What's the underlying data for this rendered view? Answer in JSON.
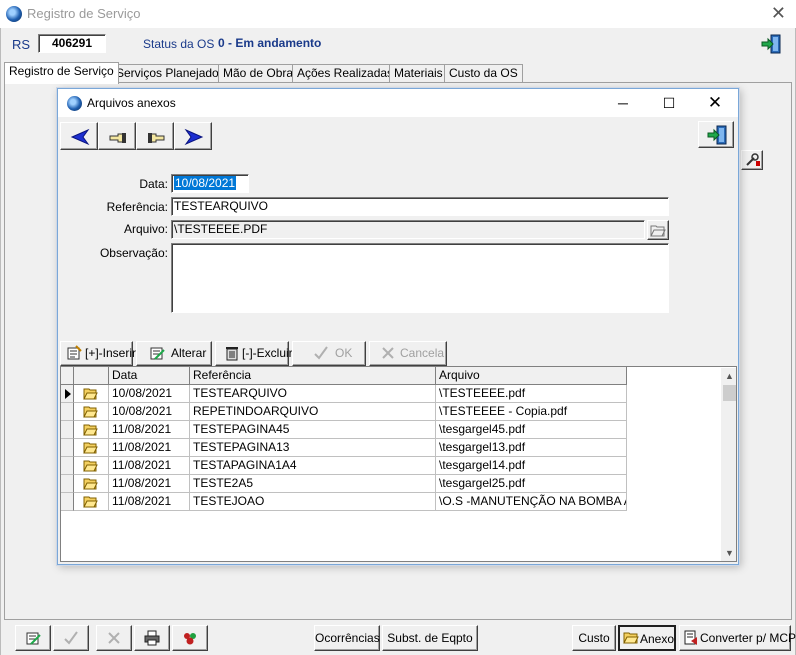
{
  "window": {
    "title": "Registro de Serviço"
  },
  "header": {
    "rs_label": "RS",
    "rs_value": "406291",
    "status_label": "Status da OS",
    "status_value": "0 - Em andamento"
  },
  "tabs": [
    {
      "label": "Registro de Serviço",
      "active": true
    },
    {
      "label": "Serviços Planejados",
      "active": false
    },
    {
      "label": "Mão de Obra",
      "active": false
    },
    {
      "label": "Ações Realizadas",
      "active": false
    },
    {
      "label": "Materiais",
      "active": false
    },
    {
      "label": "Custo da OS",
      "active": false
    }
  ],
  "dialog": {
    "title": "Arquivos anexos",
    "form": {
      "data_label": "Data:",
      "data_value": "10/08/2021",
      "referencia_label": "Referência:",
      "referencia_value": "TESTEARQUIVO",
      "arquivo_label": "Arquivo:",
      "arquivo_value": "\\TESTEEEE.PDF",
      "observacao_label": "Observação:",
      "observacao_value": ""
    },
    "grid_buttons": {
      "inserir": "[+]-Inserir",
      "alterar": "Alterar",
      "excluir": "[-]-Excluir",
      "ok": "OK",
      "cancela": "Cancela"
    },
    "grid": {
      "columns": [
        "Data",
        "Referência",
        "Arquivo"
      ],
      "rows": [
        {
          "data": "10/08/2021",
          "referencia": "TESTEARQUIVO",
          "arquivo": "\\TESTEEEE.pdf"
        },
        {
          "data": "10/08/2021",
          "referencia": "REPETINDOARQUIVO",
          "arquivo": "\\TESTEEEE - Copia.pdf"
        },
        {
          "data": "11/08/2021",
          "referencia": "TESTEPAGINA45",
          "arquivo": "\\tesgargel45.pdf"
        },
        {
          "data": "11/08/2021",
          "referencia": "TESTEPAGINA13",
          "arquivo": "\\tesgargel13.pdf"
        },
        {
          "data": "11/08/2021",
          "referencia": "TESTAPAGINA1A4",
          "arquivo": "\\tesgargel14.pdf"
        },
        {
          "data": "11/08/2021",
          "referencia": "TESTE2A5",
          "arquivo": "\\tesgargel25.pdf"
        },
        {
          "data": "11/08/2021",
          "referencia": "TESTEJOAO",
          "arquivo": "\\O.S -MANUTENÇÃO NA BOMBA AUT"
        }
      ]
    }
  },
  "bottom_bar": {
    "ocorrencias": "Ocorrências",
    "subst_eqpto": "Subst. de Eqpto",
    "custo": "Custo",
    "anexo": "Anexo",
    "converter": "Converter p/ MCP"
  },
  "colors": {
    "accent_blue": "#1a3a8a",
    "selection": "#0078d7",
    "arrow_blue": "#1d2fd0"
  }
}
